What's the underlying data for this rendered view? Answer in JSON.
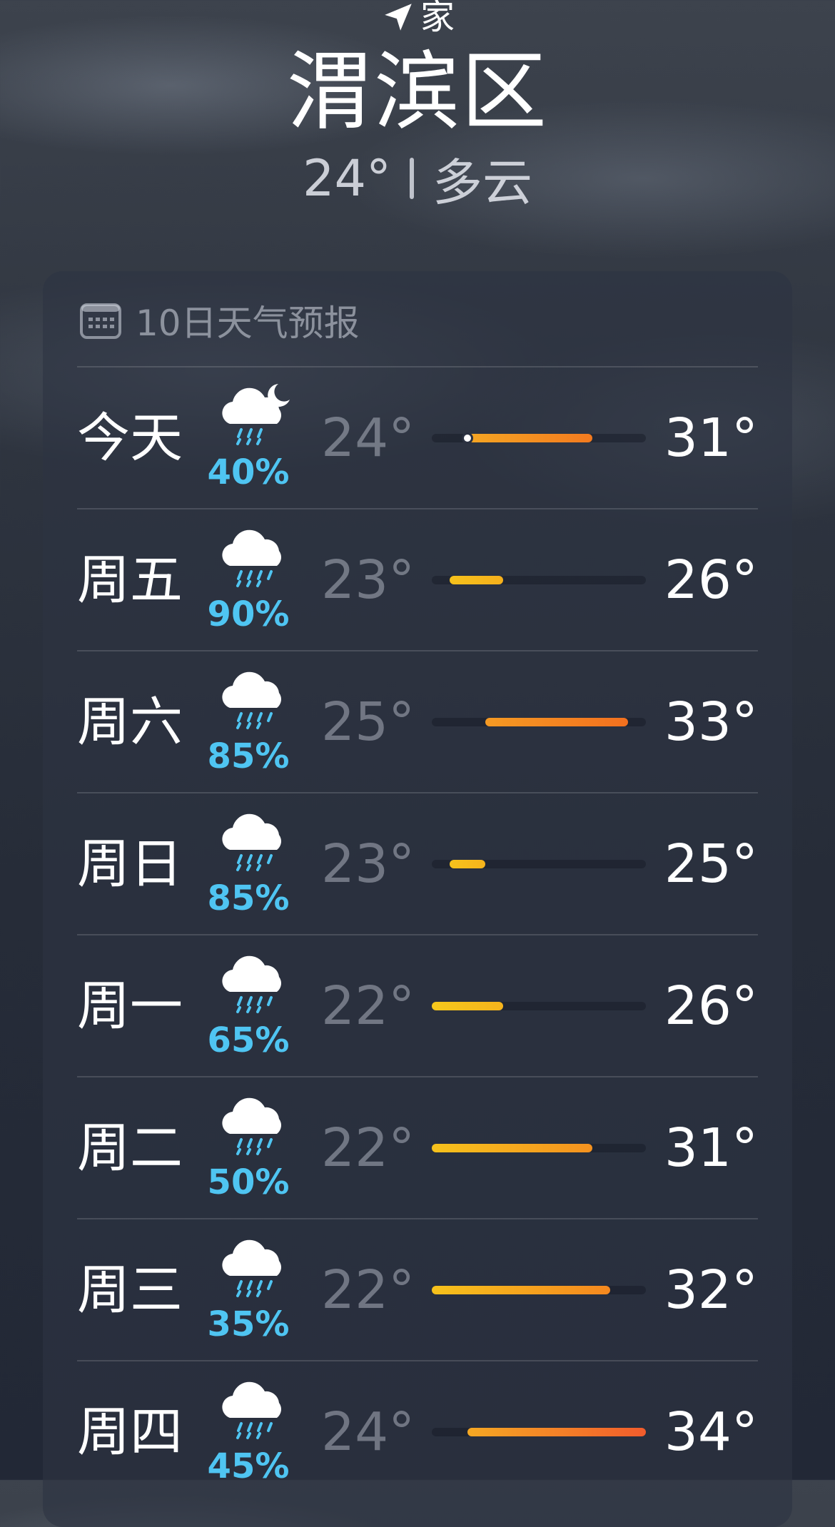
{
  "header": {
    "location_label": "家",
    "location_icon": "location-arrow-icon",
    "city": "渭滨区",
    "current_temp": "24°",
    "condition": "多云"
  },
  "forecast": {
    "title": "10日天气预报",
    "title_icon": "calendar-icon",
    "range": {
      "min": 22,
      "max": 34
    },
    "current_temp_value": 24,
    "days": [
      {
        "day": "今天",
        "icon": "cloud-moon-rain-icon",
        "precip": "40%",
        "low": "24°",
        "high": "31°",
        "low_val": 24,
        "high_val": 31,
        "bar_color": [
          "#f5a623",
          "#f37a1f"
        ]
      },
      {
        "day": "周五",
        "icon": "cloud-rain-icon",
        "precip": "90%",
        "low": "23°",
        "high": "26°",
        "low_val": 23,
        "high_val": 26,
        "bar_color": [
          "#f6c21c",
          "#f6b01c"
        ]
      },
      {
        "day": "周六",
        "icon": "cloud-rain-icon",
        "precip": "85%",
        "low": "25°",
        "high": "33°",
        "low_val": 25,
        "high_val": 33,
        "bar_color": [
          "#f59a23",
          "#f3701f"
        ]
      },
      {
        "day": "周日",
        "icon": "cloud-rain-icon",
        "precip": "85%",
        "low": "23°",
        "high": "25°",
        "low_val": 23,
        "high_val": 25,
        "bar_color": [
          "#f6c21c",
          "#f6b41c"
        ]
      },
      {
        "day": "周一",
        "icon": "cloud-rain-icon",
        "precip": "65%",
        "low": "22°",
        "high": "26°",
        "low_val": 22,
        "high_val": 26,
        "bar_color": [
          "#f6c81c",
          "#f6b41c"
        ]
      },
      {
        "day": "周二",
        "icon": "cloud-rain-icon",
        "precip": "50%",
        "low": "22°",
        "high": "31°",
        "low_val": 22,
        "high_val": 31,
        "bar_color": [
          "#f6c21c",
          "#f5921f"
        ]
      },
      {
        "day": "周三",
        "icon": "cloud-rain-icon",
        "precip": "35%",
        "low": "22°",
        "high": "32°",
        "low_val": 22,
        "high_val": 32,
        "bar_color": [
          "#f6c21c",
          "#f5881f"
        ]
      },
      {
        "day": "周四",
        "icon": "cloud-rain-icon",
        "precip": "45%",
        "low": "24°",
        "high": "34°",
        "low_val": 24,
        "high_val": 34,
        "bar_color": [
          "#f5a823",
          "#f25c2c"
        ]
      }
    ]
  }
}
